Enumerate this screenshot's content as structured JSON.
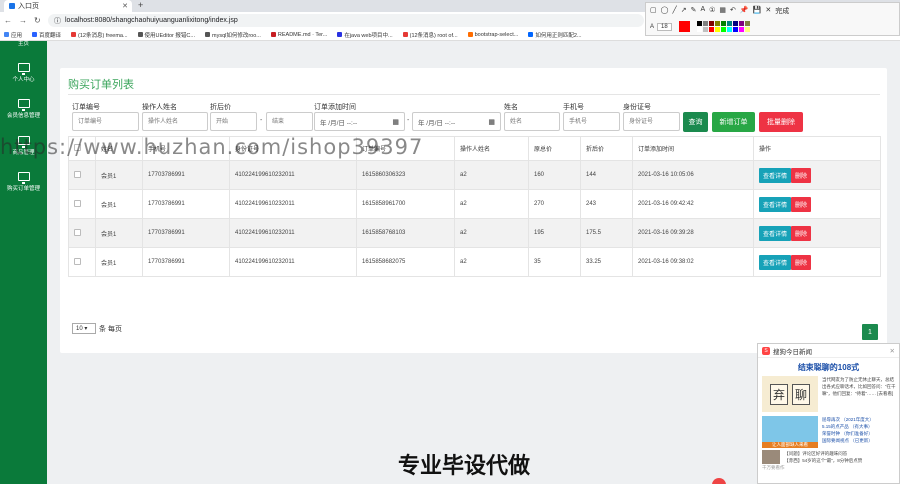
{
  "browser": {
    "tab_title": "入口页",
    "url": "localhost:8080/shangchaohuiyuanguanlixitong/index.jsp",
    "bookmarks": [
      "应用",
      "百度翻译",
      "(12条消息) freema...",
      "使用UEditor 报错C...",
      "mysql如何修改roo...",
      "README.md · Ter...",
      "在java web项目中...",
      "(12条消息) root of...",
      "bootstrap-select...",
      "如何用正则匹配2..."
    ],
    "new_tab": "+"
  },
  "snip_tool": {
    "font_label": "A",
    "font_size": "18",
    "finish_label": "完成",
    "colors": [
      "#000000",
      "#808080",
      "#800000",
      "#808000",
      "#008000",
      "#008080",
      "#000080",
      "#800080",
      "#808040",
      "#ffffff",
      "#c0c0c0",
      "#ff0000",
      "#ffff00",
      "#00ff00",
      "#00ffff",
      "#0000ff",
      "#ff00ff",
      "#ffff80"
    ]
  },
  "sidebar": {
    "items": [
      {
        "label": "个人中心",
        "icon": "monitor-icon"
      },
      {
        "label": "会员信息管理",
        "icon": "monitor-icon"
      },
      {
        "label": "商品管理",
        "icon": "monitor-icon"
      },
      {
        "label": "购买订单管理",
        "icon": "monitor-icon"
      }
    ],
    "partial_top": "主页"
  },
  "page": {
    "title": "购买订单列表",
    "filters": {
      "order_no": {
        "label": "订单编号",
        "placeholder": "订单编号"
      },
      "operator": {
        "label": "操作人姓名",
        "placeholder": "操作人姓名"
      },
      "discount": {
        "label": "折后价",
        "start_placeholder": "开始",
        "end_placeholder": "结束"
      },
      "added_time": {
        "label": "订单添加时间",
        "date_placeholder": "年 /月/日 --:--"
      },
      "name": {
        "label": "姓名",
        "placeholder": "姓名"
      },
      "phone": {
        "label": "手机号",
        "placeholder": "手机号"
      },
      "idcard": {
        "label": "身份证号",
        "placeholder": "身份证号"
      }
    },
    "buttons": {
      "search": "查询",
      "add": "新增订单",
      "batch_delete": "批量删除"
    },
    "table": {
      "headers": [
        "",
        "姓名",
        "手机号",
        "身份证号",
        "订单编号",
        "操作人姓名",
        "原总价",
        "折后价",
        "订单添加时间",
        "操作"
      ],
      "rows": [
        {
          "name": "会员1",
          "phone": "17703786991",
          "idcard": "410224199610232011",
          "order_no": "1615860306323",
          "operator": "a2",
          "total": "160",
          "discount": "144",
          "time": "2021-03-16 10:05:06"
        },
        {
          "name": "会员1",
          "phone": "17703786991",
          "idcard": "410224199610232011",
          "order_no": "1615858961700",
          "operator": "a2",
          "total": "270",
          "discount": "243",
          "time": "2021-03-16 09:42:42"
        },
        {
          "name": "会员1",
          "phone": "17703786991",
          "idcard": "410224199610232011",
          "order_no": "1615858768103",
          "operator": "a2",
          "total": "195",
          "discount": "175.5",
          "time": "2021-03-16 09:39:28"
        },
        {
          "name": "会员1",
          "phone": "17703786991",
          "idcard": "410224199610232011",
          "order_no": "1615858682075",
          "operator": "a2",
          "total": "35",
          "discount": "33.25",
          "time": "2021-03-16 09:38:02"
        }
      ],
      "view_label": "查看详情",
      "delete_label": "删除"
    },
    "pagination": {
      "page_size": "10",
      "page_size_suffix": "条 每页",
      "current_page": "1"
    }
  },
  "overlays": {
    "watermark": "https://www.huzhan.com/ishop39397",
    "promo": "专业毕设代做"
  },
  "news_popup": {
    "header": "搜狗今日新闻",
    "headline": "结束聪聊的108式",
    "img_chars": [
      "弃",
      "聊"
    ],
    "body": "当代网友为了防止无休止聊天，总结出各式应聊话术，比如回答问：“在干嘛”，他们回复：“待着”…… [去看看]",
    "list": [
      "屈辱再次 （2021年度大）",
      "5.15的点产品 （有大事）",
      "荣誉时钟 （你们准备好）",
      "国际要闻视点 （已更新）"
    ],
    "ad_caption": "让人面部缺人来看",
    "foot": [
      "【问题】评论区好评的趣味问答",
      "【赤西】54岁的这个“最”，8分钟后点赞"
    ],
    "foot_tail": "千万要看作"
  }
}
